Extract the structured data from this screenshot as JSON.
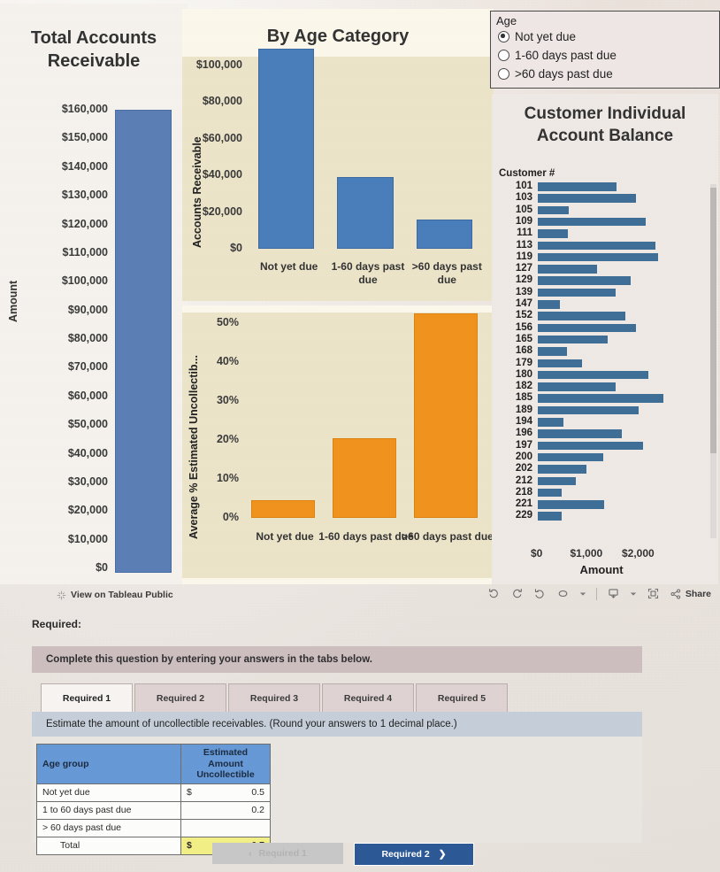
{
  "dashboard": {
    "total_panel": {
      "title": "Total Accounts Receivable",
      "ylabel": "Amount"
    },
    "age_panel": {
      "title": "By Age Category",
      "ylabel": "Accounts Receivable"
    },
    "pct_panel": {
      "ylabel": "Average % Estimated Uncollectib..."
    },
    "age_filter": {
      "title": "Age",
      "options": [
        {
          "label": "Not yet due",
          "selected": true
        },
        {
          "label": "1-60 days past due",
          "selected": false
        },
        {
          "label": ">60 days past due",
          "selected": false
        }
      ]
    },
    "customer_panel": {
      "title": "Customer Individual Account Balance",
      "row_header": "Customer #",
      "xlabel": "Amount"
    }
  },
  "chart_data": [
    {
      "type": "bar",
      "title": "Total Accounts Receivable",
      "xlabel": "",
      "ylabel": "Amount",
      "categories": [
        "Total"
      ],
      "values": [
        161000
      ],
      "ylim": [
        0,
        160000
      ],
      "ytick_labels": [
        "$160,000",
        "$150,000",
        "$140,000",
        "$130,000",
        "$120,000",
        "$110,000",
        "$100,000",
        "$90,000",
        "$80,000",
        "$70,000",
        "$60,000",
        "$50,000",
        "$40,000",
        "$30,000",
        "$20,000",
        "$10,000",
        "$0"
      ],
      "color": "#5b7fb5",
      "grid": false,
      "legend": "none"
    },
    {
      "type": "bar",
      "title": "By Age Category",
      "xlabel": "",
      "ylabel": "Accounts Receivable",
      "categories": [
        "Not yet due",
        "1-60 days past due",
        ">60 days past due"
      ],
      "values": [
        108000,
        38000,
        15000
      ],
      "ylim": [
        0,
        100000
      ],
      "ytick_labels": [
        "$100,000",
        "$80,000",
        "$60,000",
        "$40,000",
        "$20,000",
        "$0"
      ],
      "color": "#4a7ebb",
      "grid": false,
      "legend": "none"
    },
    {
      "type": "bar",
      "title": "",
      "xlabel": "",
      "ylabel": "Average % Estimated Uncollectib...",
      "categories": [
        "Not yet due",
        "1-60 days past due",
        ">60 days past due"
      ],
      "values": [
        4,
        20,
        52
      ],
      "ylim": [
        0,
        50
      ],
      "ytick_labels": [
        "50%",
        "40%",
        "30%",
        "20%",
        "10%",
        "0%"
      ],
      "color": "#f0921e",
      "grid": false,
      "legend": "none"
    },
    {
      "type": "bar",
      "orientation": "horizontal",
      "title": "Customer Individual Account Balance",
      "xlabel": "Amount",
      "ylabel": "Customer #",
      "categories": [
        "101",
        "103",
        "105",
        "109",
        "111",
        "113",
        "119",
        "127",
        "129",
        "139",
        "147",
        "152",
        "156",
        "165",
        "168",
        "179",
        "180",
        "182",
        "185",
        "189",
        "194",
        "196",
        "197",
        "200",
        "202",
        "212",
        "218",
        "221",
        "229"
      ],
      "values": [
        1520,
        1900,
        600,
        2090,
        580,
        2280,
        2320,
        1150,
        1800,
        1500,
        420,
        1700,
        1900,
        1350,
        560,
        850,
        2130,
        1510,
        2420,
        1950,
        490,
        1630,
        2030,
        1260,
        940,
        740,
        470,
        1280,
        470
      ],
      "xlim": [
        0,
        2500
      ],
      "xtick_labels": [
        "$0",
        "$1,000",
        "$2,000"
      ],
      "color": "#3f6e97",
      "grid": false,
      "legend": "none"
    }
  ],
  "toolbar": {
    "tableau_link": "View on Tableau Public",
    "share_label": "Share",
    "icons": [
      "undo-icon",
      "redo-icon",
      "revert-icon",
      "refresh-icon",
      "caret-down-icon",
      "download-icon",
      "fullscreen-icon",
      "share-icon"
    ]
  },
  "question": {
    "required_label": "Required:",
    "banner": "Complete this question by entering your answers in the tabs below.",
    "tabs": [
      {
        "label": "Required 1",
        "active": true
      },
      {
        "label": "Required 2",
        "active": false
      },
      {
        "label": "Required 3",
        "active": false
      },
      {
        "label": "Required 4",
        "active": false
      },
      {
        "label": "Required 5",
        "active": false
      }
    ],
    "instruction": "Estimate the amount of uncollectible receivables. (Round your answers to 1 decimal place.)",
    "table": {
      "headers": [
        "Age group",
        "Estimated Amount Uncollectible"
      ],
      "header_right_lines": [
        "Estimated",
        "Amount",
        "Uncollectible"
      ],
      "rows": [
        {
          "label": "Not yet due",
          "currency": "$",
          "value": "0.5"
        },
        {
          "label": "1 to 60 days past due",
          "currency": "",
          "value": "0.2"
        },
        {
          "label": "> 60 days past due",
          "currency": "",
          "value": ""
        },
        {
          "label": "Total",
          "currency": "$",
          "value": "0.7",
          "total": true
        }
      ]
    },
    "nav": {
      "prev": "Required 1",
      "next": "Required 2"
    }
  }
}
